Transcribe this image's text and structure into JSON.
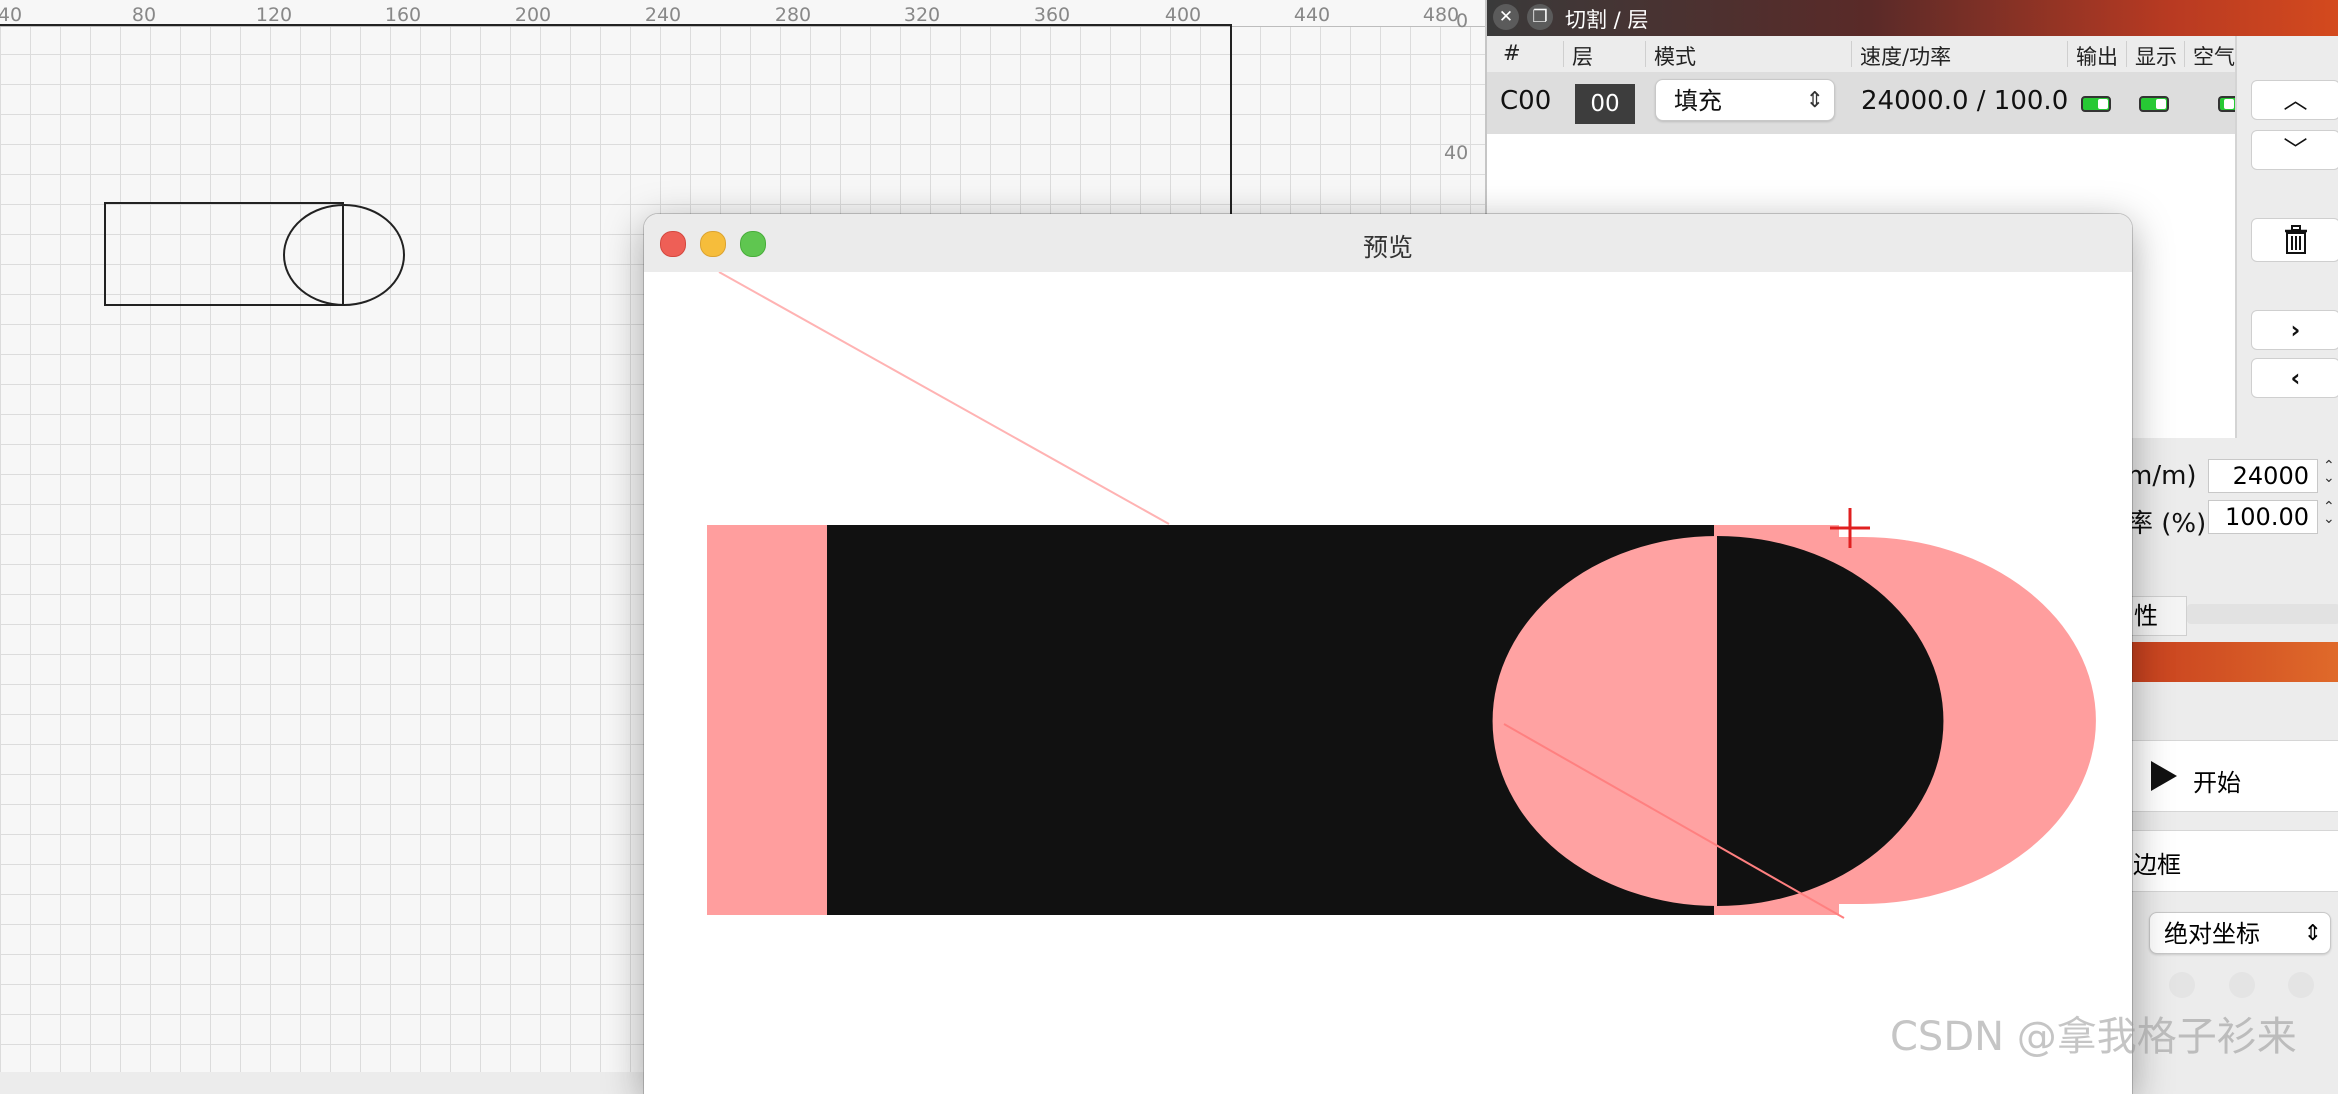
{
  "ruler": {
    "top_ticks": [
      "40",
      "80",
      "120",
      "160",
      "200",
      "240",
      "280",
      "320",
      "360",
      "400",
      "440",
      "480"
    ],
    "side_ticks": [
      "0",
      "40"
    ]
  },
  "layers_panel": {
    "title": "切割 / 层",
    "columns": [
      "#",
      "层",
      "模式",
      "速度/功率",
      "输出",
      "显示",
      "空气"
    ],
    "rows": [
      {
        "id": "C00",
        "layer": "00",
        "mode": "填充",
        "speed_power": "24000.0 / 100.0",
        "output": true,
        "show": true
      }
    ],
    "side_buttons": {
      "up": "⌃",
      "down": "⌄",
      "delete": "🗑",
      "next": "›",
      "prev": "‹"
    }
  },
  "params": {
    "speed_label": "m/m)",
    "speed_value": "24000",
    "power_label": "率 (%)",
    "power_value": "100.00"
  },
  "properties_tab": "性",
  "laser": {
    "start_label": "开始",
    "frame_label": "边框",
    "coord_mode": "绝对坐标"
  },
  "preview": {
    "title": "预览",
    "fill_color": "#111111",
    "travel_color": "#ff9e9e"
  },
  "watermark": "CSDN @拿我格子衫来"
}
